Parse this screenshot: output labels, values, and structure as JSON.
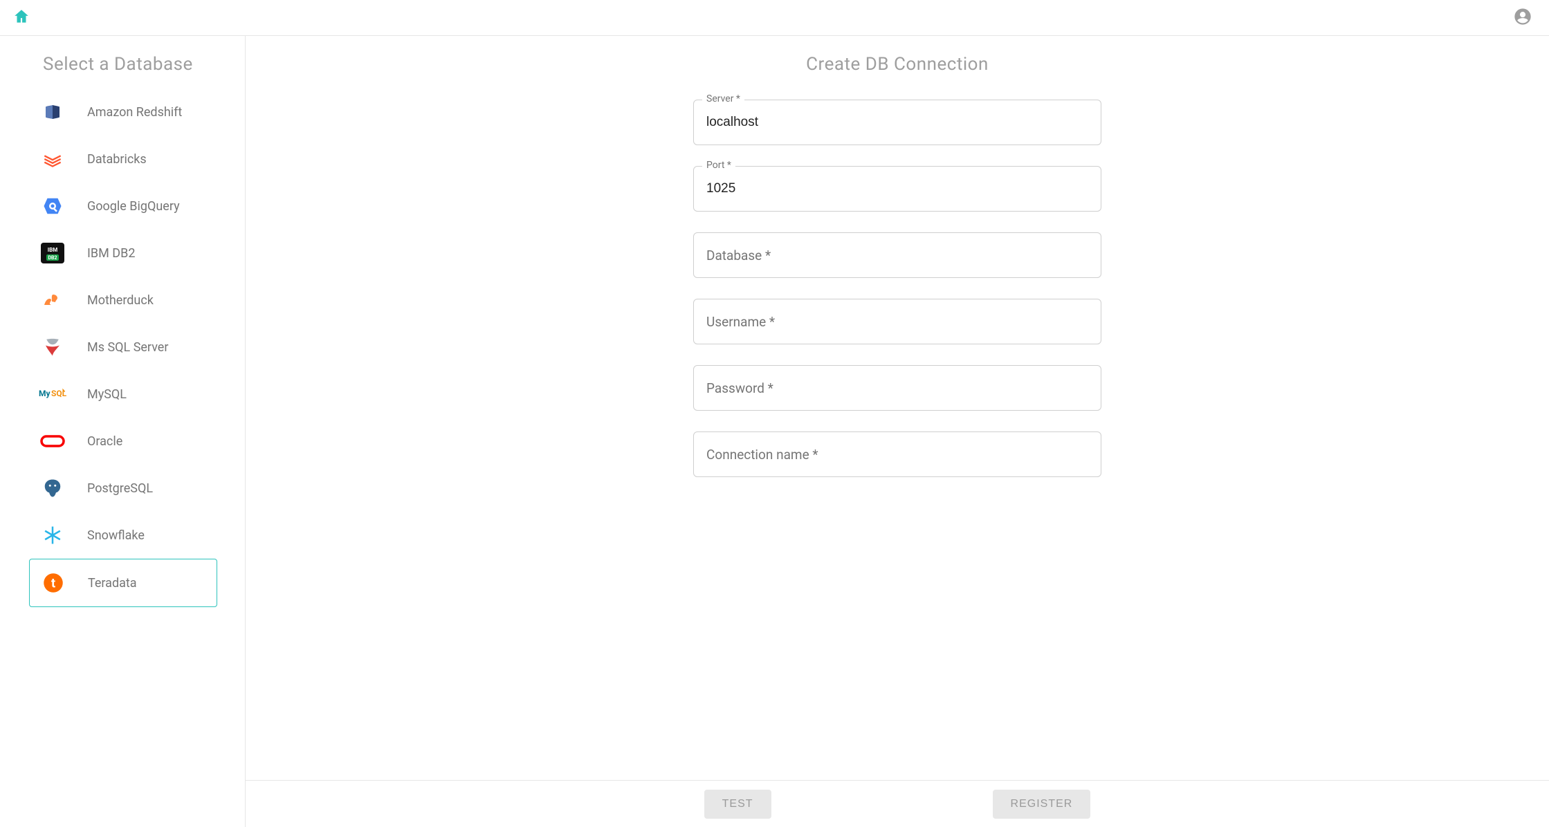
{
  "topbar": {
    "home_name": "home-icon",
    "account_name": "account-icon"
  },
  "sidebar": {
    "title": "Select a Database",
    "items": [
      {
        "label": "Amazon Redshift"
      },
      {
        "label": "Databricks"
      },
      {
        "label": "Google BigQuery"
      },
      {
        "label": "IBM DB2"
      },
      {
        "label": "Motherduck"
      },
      {
        "label": "Ms SQL Server"
      },
      {
        "label": "MySQL"
      },
      {
        "label": "Oracle"
      },
      {
        "label": "PostgreSQL"
      },
      {
        "label": "Snowflake"
      },
      {
        "label": "Teradata"
      }
    ],
    "selected_index": 10
  },
  "main": {
    "title": "Create DB Connection",
    "fields": {
      "server": {
        "label": "Server *",
        "value": "localhost"
      },
      "port": {
        "label": "Port *",
        "value": "1025"
      },
      "database": {
        "label": "Database *",
        "value": ""
      },
      "username": {
        "label": "Username *",
        "value": ""
      },
      "password": {
        "label": "Password *",
        "value": ""
      },
      "connection_name": {
        "label": "Connection name *",
        "value": ""
      }
    }
  },
  "footer": {
    "test_label": "TEST",
    "register_label": "REGISTER"
  }
}
